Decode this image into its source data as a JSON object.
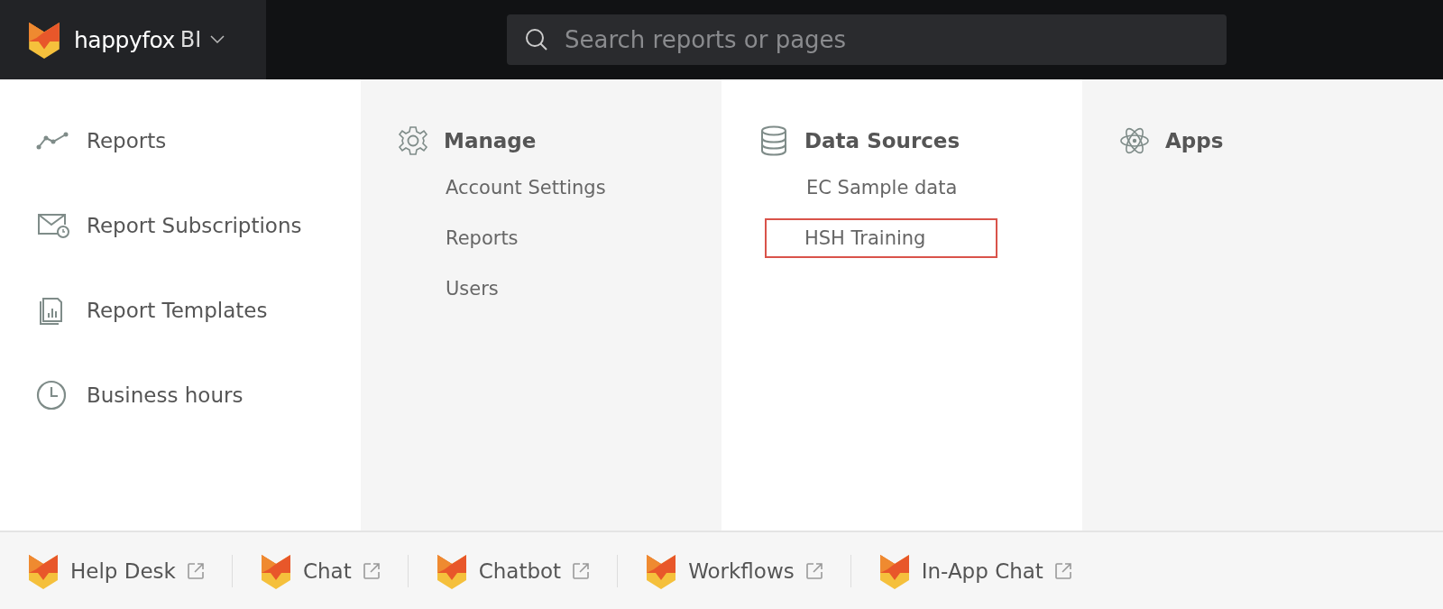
{
  "header": {
    "brand": "happyfox",
    "product": "BI",
    "search": {
      "placeholder": "Search reports or pages"
    }
  },
  "columns": [
    {
      "kind": "links",
      "items": [
        {
          "label": "Reports"
        },
        {
          "label": "Report Subscriptions"
        },
        {
          "label": "Report Templates"
        },
        {
          "label": "Business hours"
        }
      ]
    },
    {
      "kind": "section",
      "title": "Manage",
      "items": [
        {
          "label": "Account Settings",
          "highlighted": false
        },
        {
          "label": "Reports",
          "highlighted": false
        },
        {
          "label": "Users",
          "highlighted": false
        }
      ]
    },
    {
      "kind": "section",
      "title": "Data Sources",
      "items": [
        {
          "label": "EC Sample data",
          "highlighted": false
        },
        {
          "label": "HSH Training",
          "highlighted": true
        }
      ]
    },
    {
      "kind": "section",
      "title": "Apps"
    }
  ],
  "footer": [
    {
      "label": "Help Desk"
    },
    {
      "label": "Chat"
    },
    {
      "label": "Chatbot"
    },
    {
      "label": "Workflows"
    },
    {
      "label": "In-App Chat"
    }
  ]
}
